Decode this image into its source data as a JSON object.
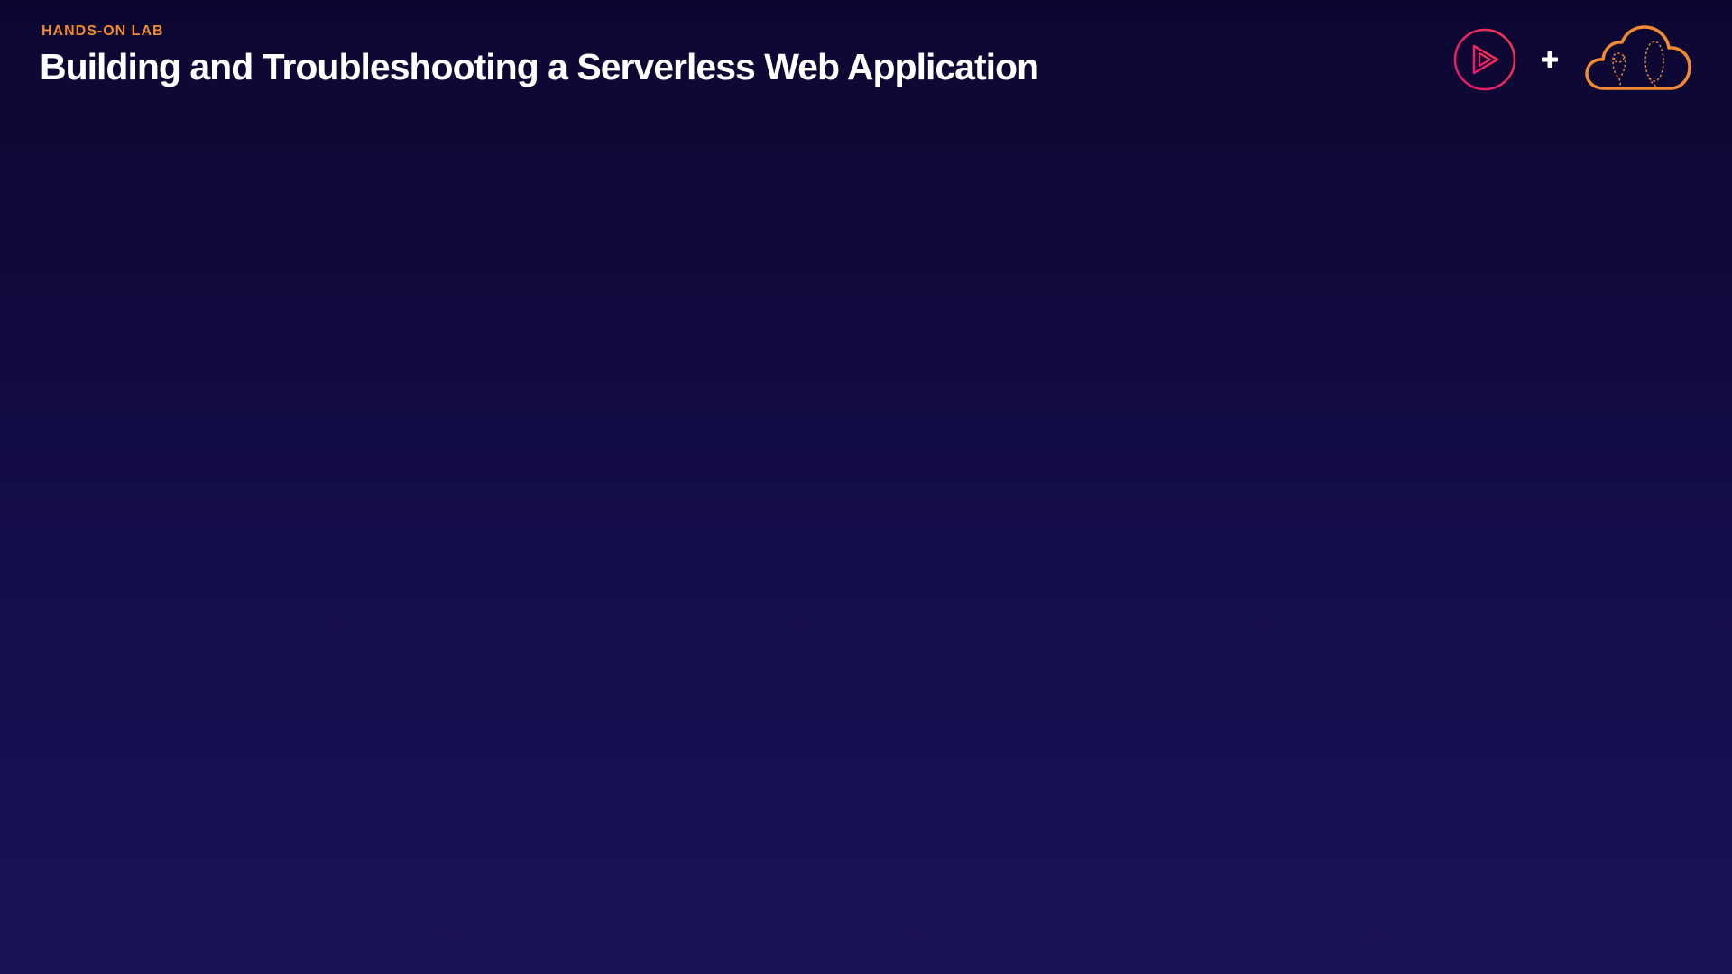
{
  "header": {
    "eyebrow": "HANDS-ON LAB",
    "title": "Building and Troubleshooting a Serverless Web Application"
  },
  "logos": {
    "play_logo": "play-circle-icon",
    "plus": "plus-icon",
    "cloud_logo": "cloud-icon"
  },
  "colors": {
    "background_top": "#0c0731",
    "background_bottom": "#1a1356",
    "eyebrow": "#f28a32",
    "title": "#ffffff",
    "play_logo_start": "#e8166f",
    "play_logo_end": "#f5394b",
    "cloud_logo": "#f28a32"
  }
}
